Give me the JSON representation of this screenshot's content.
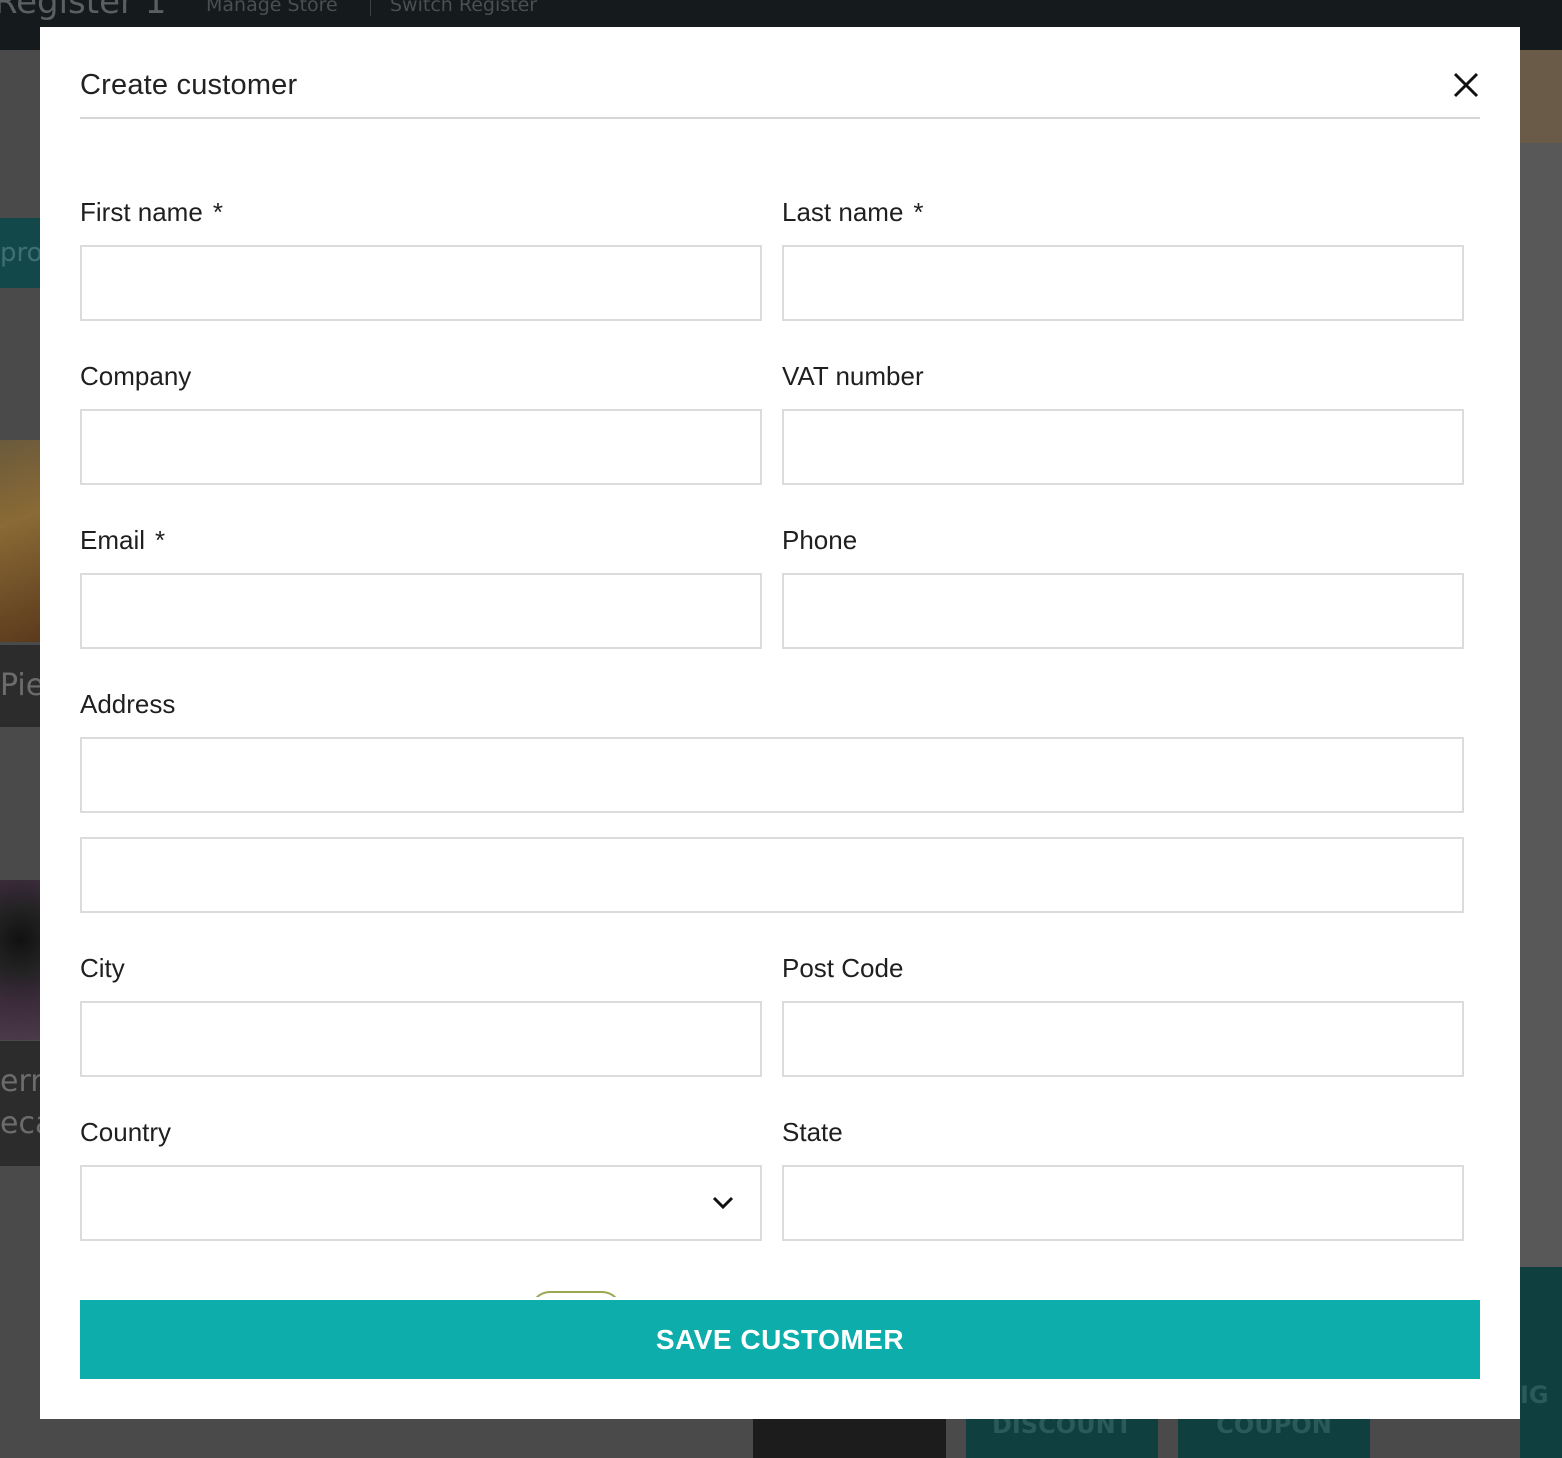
{
  "background": {
    "app_title": "Register 1",
    "nav": [
      "Manage Store",
      "Switch Register"
    ],
    "left_tab_text": "prod",
    "left_product_labels": [
      "Pie",
      "err",
      "eca"
    ],
    "bottom_buttons": [
      "DISCOUNT",
      "COUPON",
      "IG"
    ]
  },
  "modal": {
    "title": "Create customer",
    "close_icon": "close-icon",
    "fields": {
      "first_name": {
        "label": "First name",
        "required_mark": "*",
        "value": ""
      },
      "last_name": {
        "label": "Last name",
        "required_mark": "*",
        "value": ""
      },
      "company": {
        "label": "Company",
        "value": ""
      },
      "vat_number": {
        "label": "VAT number",
        "value": ""
      },
      "email": {
        "label": "Email",
        "required_mark": "*",
        "value": ""
      },
      "phone": {
        "label": "Phone",
        "value": ""
      },
      "address": {
        "label": "Address",
        "line1": "",
        "line2": ""
      },
      "city": {
        "label": "City",
        "value": ""
      },
      "post_code": {
        "label": "Post Code",
        "value": ""
      },
      "country": {
        "label": "Country",
        "selected": ""
      },
      "state": {
        "label": "State",
        "value": ""
      }
    },
    "save_label": "SAVE CUSTOMER"
  },
  "colors": {
    "accent": "#0cadaa",
    "overlay": "#4a4a4a",
    "field_border": "#dcdcdc"
  }
}
